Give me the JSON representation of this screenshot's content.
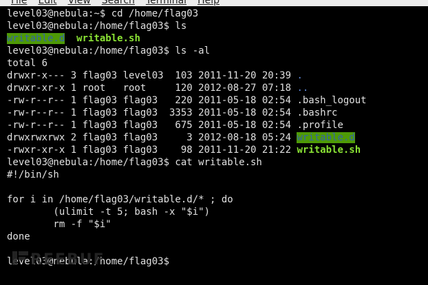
{
  "menu": {
    "items": [
      "File",
      "Edit",
      "View",
      "Search",
      "Terminal",
      "Help"
    ]
  },
  "colors": {
    "background": "#000000",
    "text": "#e0e0e0",
    "executable": "#8ae234",
    "directory": "#5f87d7",
    "highlight_bg": "#4e9a06",
    "highlight_text": "#3465a4"
  },
  "terminal": {
    "line1": "level03@nebula:~$ cd /home/flag03",
    "line2": "level03@nebula:/home/flag03$ ls",
    "line3_dir": "writable.d",
    "line3_file": "writable.sh",
    "line4": "level03@nebula:/home/flag03$ ls -al",
    "line5": "total 6",
    "listing": [
      {
        "prefix": "drwxr-x--- 3 flag03 level03  103 2011-11-20 20:39 ",
        "name": "."
      },
      {
        "prefix": "drwxr-xr-x 1 root   root     120 2012-08-27 07:18 ",
        "name": ".."
      },
      {
        "prefix": "-rw-r--r-- 1 flag03 flag03   220 2011-05-18 02:54 ",
        "name": ".bash_logout"
      },
      {
        "prefix": "-rw-r--r-- 1 flag03 flag03  3353 2011-05-18 02:54 ",
        "name": ".bashrc"
      },
      {
        "prefix": "-rw-r--r-- 1 flag03 flag03   675 2011-05-18 02:54 ",
        "name": ".profile"
      },
      {
        "prefix": "drwxrwxrwx 2 flag03 flag03     3 2012-08-18 05:24 ",
        "name": "writable.d"
      },
      {
        "prefix": "-rwxr-xr-x 1 flag03 flag03    98 2011-11-20 21:22 ",
        "name": "writable.sh"
      }
    ],
    "line13": "level03@nebula:/home/flag03$ cat writable.sh",
    "line14": "#!/bin/sh",
    "line16": "for i in /home/flag03/writable.d/* ; do",
    "line17": "        (ulimit -t 5; bash -x \"$i\")",
    "line18": "        rm -f \"$i\"",
    "line19": "done",
    "line21": "level03@nebula:/home/flag03$ "
  },
  "watermark": {
    "icon": "freebuf-logo",
    "text": "REEBUF"
  }
}
